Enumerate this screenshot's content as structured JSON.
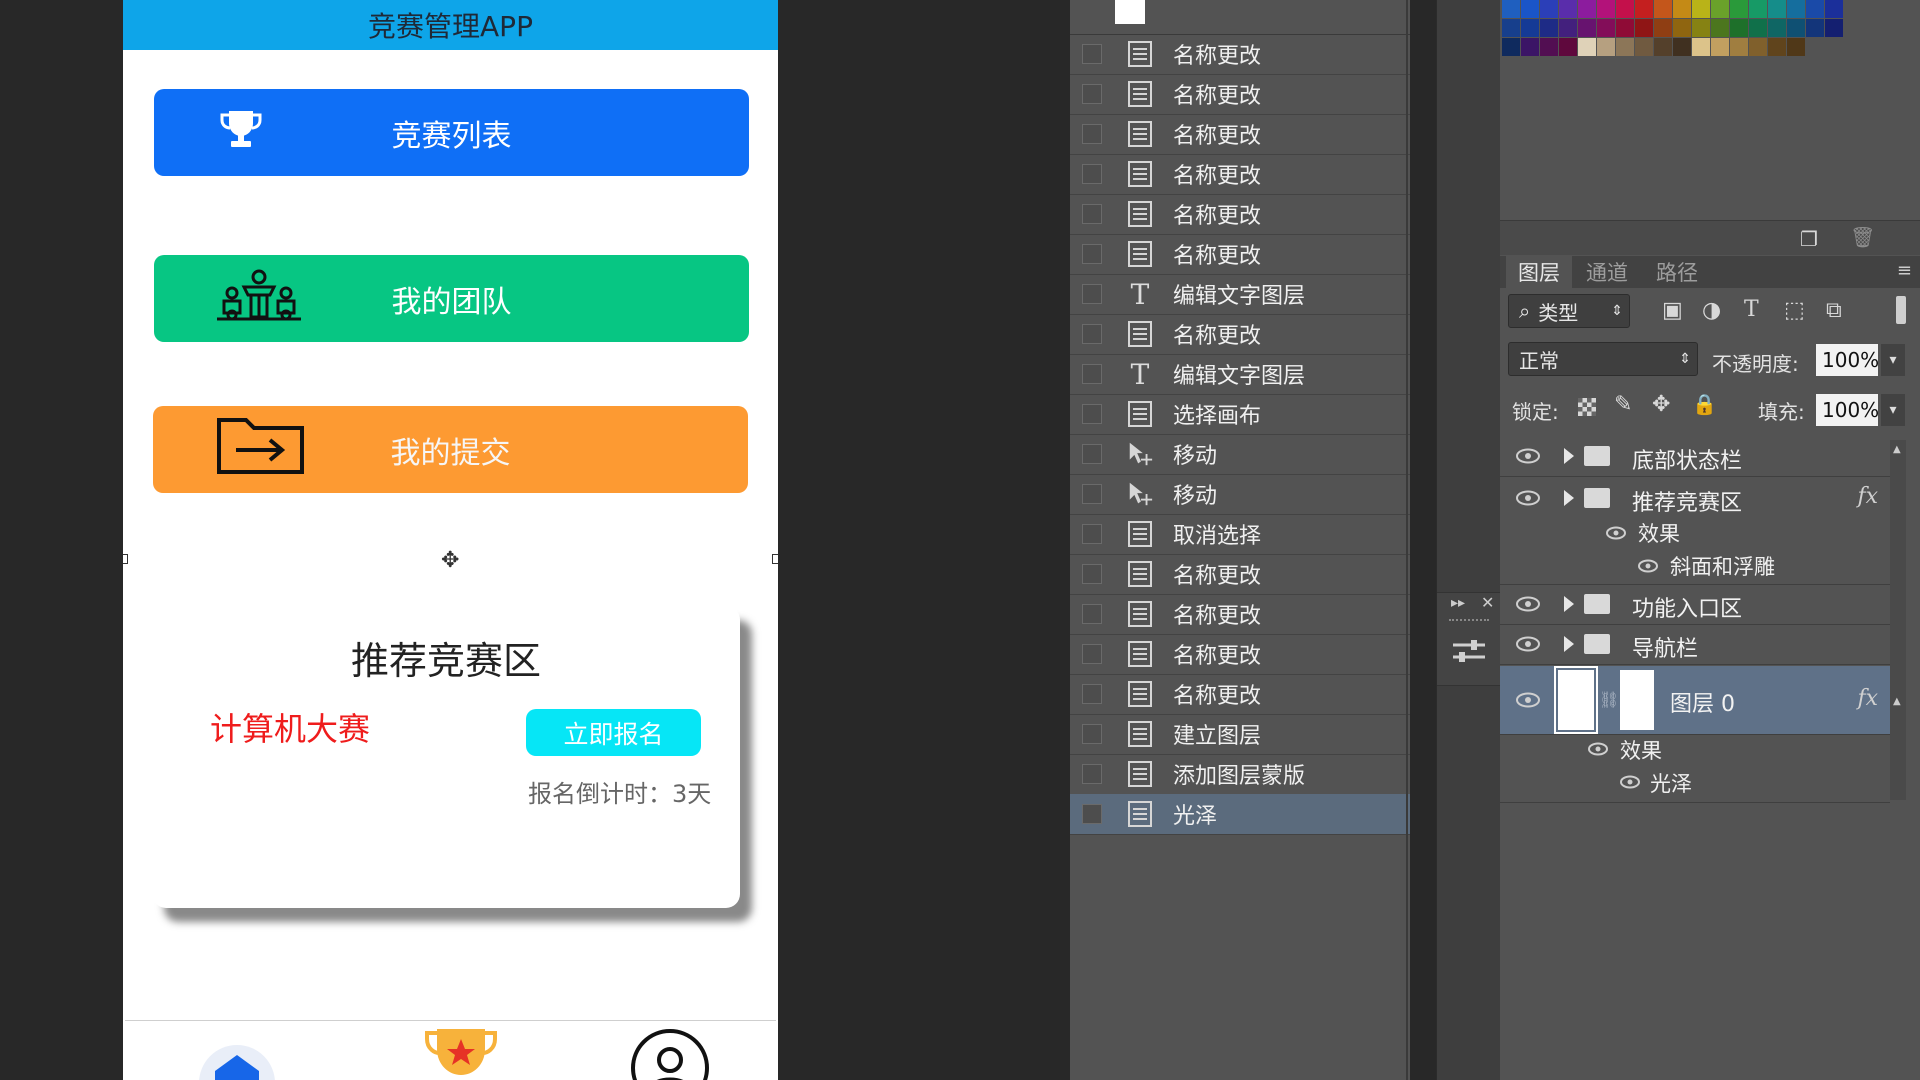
{
  "app": {
    "title": "竞赛管理APP",
    "buttons": {
      "list": "竞赛列表",
      "team": "我的团队",
      "submit": "我的提交"
    },
    "recommend": {
      "title": "推荐竞赛区",
      "competition": "计算机大赛",
      "signup": "立即报名",
      "countdown": "报名倒计时：3天"
    }
  },
  "history": {
    "items": [
      {
        "icon": "doc",
        "label": "名称更改"
      },
      {
        "icon": "doc",
        "label": "名称更改"
      },
      {
        "icon": "doc",
        "label": "名称更改"
      },
      {
        "icon": "doc",
        "label": "名称更改"
      },
      {
        "icon": "doc",
        "label": "名称更改"
      },
      {
        "icon": "doc",
        "label": "名称更改"
      },
      {
        "icon": "text",
        "label": "编辑文字图层"
      },
      {
        "icon": "doc",
        "label": "名称更改"
      },
      {
        "icon": "text",
        "label": "编辑文字图层"
      },
      {
        "icon": "doc",
        "label": "选择画布"
      },
      {
        "icon": "move",
        "label": "移动"
      },
      {
        "icon": "move",
        "label": "移动"
      },
      {
        "icon": "doc",
        "label": "取消选择"
      },
      {
        "icon": "doc",
        "label": "名称更改"
      },
      {
        "icon": "doc",
        "label": "名称更改"
      },
      {
        "icon": "doc",
        "label": "名称更改"
      },
      {
        "icon": "doc",
        "label": "名称更改"
      },
      {
        "icon": "doc",
        "label": "建立图层"
      },
      {
        "icon": "doc",
        "label": "添加图层蒙版"
      },
      {
        "icon": "doc",
        "label": "光泽"
      }
    ]
  },
  "layers_panel": {
    "tabs": [
      "图层",
      "通道",
      "路径"
    ],
    "filter_label": "类型",
    "blend_mode": "正常",
    "opacity_label": "不透明度:",
    "opacity_value": "100%",
    "lock_label": "锁定:",
    "fill_label": "填充:",
    "fill_value": "100%",
    "layers": [
      {
        "name": "底部状态栏"
      },
      {
        "name": "推荐竞赛区",
        "effects_label": "效果",
        "effects": [
          "斜面和浮雕"
        ]
      },
      {
        "name": "功能入口区"
      },
      {
        "name": "导航栏"
      },
      {
        "name": "图层 0",
        "effects_label": "效果",
        "effects": [
          "光泽"
        ]
      }
    ],
    "fx_symbol": "fx"
  },
  "colors": {
    "title_bar": "#0ea5e9",
    "btn_list": "#0f6ff6",
    "btn_team": "#07c683",
    "btn_submit": "#fd9a32",
    "signup": "#06e6f6",
    "competition_red": "#ef1c1c"
  }
}
